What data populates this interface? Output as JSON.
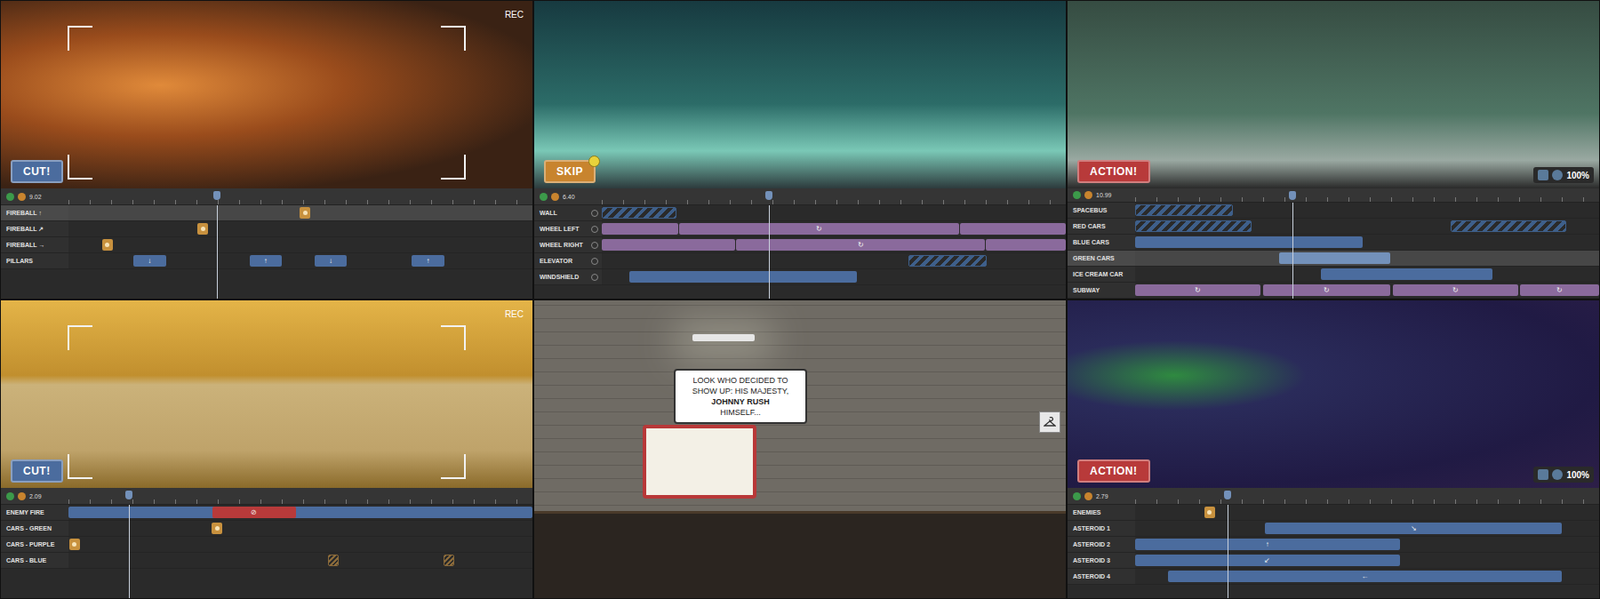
{
  "panels": [
    {
      "rec": "REC",
      "button": {
        "label": "CUT!",
        "color": "#4b6c9e",
        "badge": false
      },
      "timeline": {
        "time": "9.02",
        "playhead": 0.32,
        "toggles": false,
        "tracks": [
          {
            "label": "FIREBALL ↑",
            "selected": true,
            "clips": [
              {
                "kind": "marker",
                "start": 0.51,
                "color": "#c8913e"
              }
            ]
          },
          {
            "label": "FIREBALL ↗",
            "selected": false,
            "clips": [
              {
                "kind": "marker",
                "start": 0.29,
                "color": "#c8913e"
              }
            ]
          },
          {
            "label": "FIREBALL →",
            "selected": false,
            "clips": [
              {
                "kind": "marker",
                "start": 0.084,
                "color": "#c8913e"
              }
            ]
          },
          {
            "label": "PILLARS",
            "selected": false,
            "clips": [
              {
                "kind": "block",
                "start": 0.14,
                "end": 0.21,
                "color": "#4b6c9e",
                "glyph": "↓"
              },
              {
                "kind": "block",
                "start": 0.39,
                "end": 0.46,
                "color": "#4b6c9e",
                "glyph": "↑"
              },
              {
                "kind": "block",
                "start": 0.53,
                "end": 0.6,
                "color": "#4b6c9e",
                "glyph": "↓"
              },
              {
                "kind": "block",
                "start": 0.74,
                "end": 0.81,
                "color": "#4b6c9e",
                "glyph": "↑"
              }
            ]
          }
        ]
      }
    },
    {
      "button": {
        "label": "SKIP",
        "color": "#c8842e",
        "badge": true
      },
      "timeline": {
        "time": "6.40",
        "playhead": 0.36,
        "toggles": true,
        "tracks": [
          {
            "label": "WALL",
            "selected": false,
            "clips": [
              {
                "kind": "hatched",
                "start": 0.0,
                "end": 0.16,
                "color": "#3e5f8a"
              }
            ]
          },
          {
            "label": "WHEEL LEFT",
            "selected": false,
            "clips": [
              {
                "kind": "block",
                "start": 0.0,
                "end": 0.165,
                "color": "#8a6a9c"
              },
              {
                "kind": "block",
                "start": 0.167,
                "end": 0.77,
                "color": "#8a6a9c",
                "glyph": "↻"
              },
              {
                "kind": "block",
                "start": 0.772,
                "end": 1.0,
                "color": "#8a6a9c"
              }
            ]
          },
          {
            "label": "WHEEL RIGHT",
            "selected": false,
            "clips": [
              {
                "kind": "block",
                "start": 0.0,
                "end": 0.288,
                "color": "#8a6a9c"
              },
              {
                "kind": "block",
                "start": 0.29,
                "end": 0.825,
                "color": "#8a6a9c",
                "glyph": "↻"
              },
              {
                "kind": "block",
                "start": 0.827,
                "end": 1.0,
                "color": "#8a6a9c"
              }
            ]
          },
          {
            "label": "ELEVATOR",
            "selected": false,
            "clips": [
              {
                "kind": "hatched",
                "start": 0.66,
                "end": 0.83,
                "color": "#3e5f8a"
              }
            ]
          },
          {
            "label": "WINDSHIELD",
            "selected": false,
            "clips": [
              {
                "kind": "block",
                "start": 0.06,
                "end": 0.55,
                "color": "#4b6c9e"
              }
            ]
          }
        ]
      }
    },
    {
      "button": {
        "label": "ACTION!",
        "color": "#b83a3a",
        "badge": false
      },
      "zoom": "100%",
      "timeline": {
        "time": "10.99",
        "playhead": 0.34,
        "toggles": false,
        "tracks": [
          {
            "label": "SPACEBUS",
            "selected": false,
            "clips": [
              {
                "kind": "hatched",
                "start": 0.0,
                "end": 0.21,
                "color": "#3e5f8a"
              }
            ]
          },
          {
            "label": "RED CARS",
            "selected": false,
            "clips": [
              {
                "kind": "hatched",
                "start": 0.0,
                "end": 0.25,
                "color": "#3e5f8a"
              },
              {
                "kind": "hatched",
                "start": 0.68,
                "end": 0.93,
                "color": "#3e5f8a"
              }
            ]
          },
          {
            "label": "BLUE CARS",
            "selected": false,
            "clips": [
              {
                "kind": "block",
                "start": 0.0,
                "end": 0.49,
                "color": "#4b6c9e"
              }
            ]
          },
          {
            "label": "GREEN CARS",
            "selected": true,
            "clips": [
              {
                "kind": "block",
                "start": 0.31,
                "end": 0.55,
                "color": "#7391ba"
              }
            ]
          },
          {
            "label": "ICE CREAM CAR",
            "selected": false,
            "clips": [
              {
                "kind": "block",
                "start": 0.4,
                "end": 0.77,
                "color": "#4b6c9e"
              }
            ]
          },
          {
            "label": "SUBWAY",
            "selected": false,
            "clips": [
              {
                "kind": "block",
                "start": 0.0,
                "end": 0.27,
                "color": "#8a6a9c",
                "glyph": "↻"
              },
              {
                "kind": "block",
                "start": 0.275,
                "end": 0.55,
                "color": "#8a6a9c",
                "glyph": "↻"
              },
              {
                "kind": "block",
                "start": 0.555,
                "end": 0.825,
                "color": "#8a6a9c",
                "glyph": "↻"
              },
              {
                "kind": "block",
                "start": 0.83,
                "end": 1.0,
                "color": "#8a6a9c",
                "glyph": "↻"
              }
            ]
          }
        ]
      }
    },
    {
      "rec": "REC",
      "button": {
        "label": "CUT!",
        "color": "#4b6c9e",
        "badge": false
      },
      "timeline": {
        "time": "2.09",
        "playhead": 0.13,
        "toggles": false,
        "tracks": [
          {
            "label": "ENEMY FIRE",
            "selected": false,
            "clips": [
              {
                "kind": "block",
                "start": 0.0,
                "end": 1.0,
                "color": "#4b6c9e"
              },
              {
                "kind": "block",
                "start": 0.31,
                "end": 0.49,
                "color": "#b83a3a",
                "glyph": "⊘"
              }
            ]
          },
          {
            "label": "CARS - GREEN",
            "selected": false,
            "clips": [
              {
                "kind": "marker",
                "start": 0.32,
                "color": "#c8913e"
              }
            ]
          },
          {
            "label": "CARS - PURPLE",
            "selected": false,
            "clips": [
              {
                "kind": "marker",
                "start": 0.013,
                "color": "#c8913e"
              }
            ]
          },
          {
            "label": "CARS - BLUE",
            "selected": false,
            "clips": [
              {
                "kind": "faded",
                "start": 0.57,
                "color": "#8a6a3a"
              },
              {
                "kind": "faded",
                "start": 0.82,
                "color": "#8a6a3a"
              }
            ]
          }
        ]
      }
    },
    {
      "bubble": {
        "lines": [
          {
            "text": "LOOK WHO DECIDED TO",
            "bold": false
          },
          {
            "text": "SHOW UP: HIS MAJESTY,",
            "bold": false
          },
          {
            "text": "JOHNNY RUSH",
            "bold": true
          },
          {
            "text": "HIMSELF...",
            "bold": false
          }
        ]
      }
    },
    {
      "button": {
        "label": "ACTION!",
        "color": "#b83a3a",
        "badge": false
      },
      "zoom": "100%",
      "timeline": {
        "time": "2.79",
        "playhead": 0.2,
        "toggles": false,
        "tracks": [
          {
            "label": "ENEMIES",
            "selected": false,
            "clips": [
              {
                "kind": "marker",
                "start": 0.16,
                "color": "#c8913e"
              }
            ]
          },
          {
            "label": "ASTEROID 1",
            "selected": false,
            "clips": [
              {
                "kind": "block",
                "start": 0.28,
                "end": 0.92,
                "color": "#4b6c9e",
                "glyph": "↘"
              }
            ]
          },
          {
            "label": "ASTEROID 2",
            "selected": false,
            "clips": [
              {
                "kind": "block",
                "start": 0.0,
                "end": 0.57,
                "color": "#4b6c9e",
                "glyph": "↑"
              }
            ]
          },
          {
            "label": "ASTEROID 3",
            "selected": false,
            "clips": [
              {
                "kind": "block",
                "start": 0.0,
                "end": 0.57,
                "color": "#4b6c9e",
                "glyph": "↙"
              }
            ]
          },
          {
            "label": "ASTEROID 4",
            "selected": false,
            "clips": [
              {
                "kind": "block",
                "start": 0.07,
                "end": 0.92,
                "color": "#4b6c9e",
                "glyph": "←"
              }
            ]
          }
        ]
      }
    }
  ]
}
